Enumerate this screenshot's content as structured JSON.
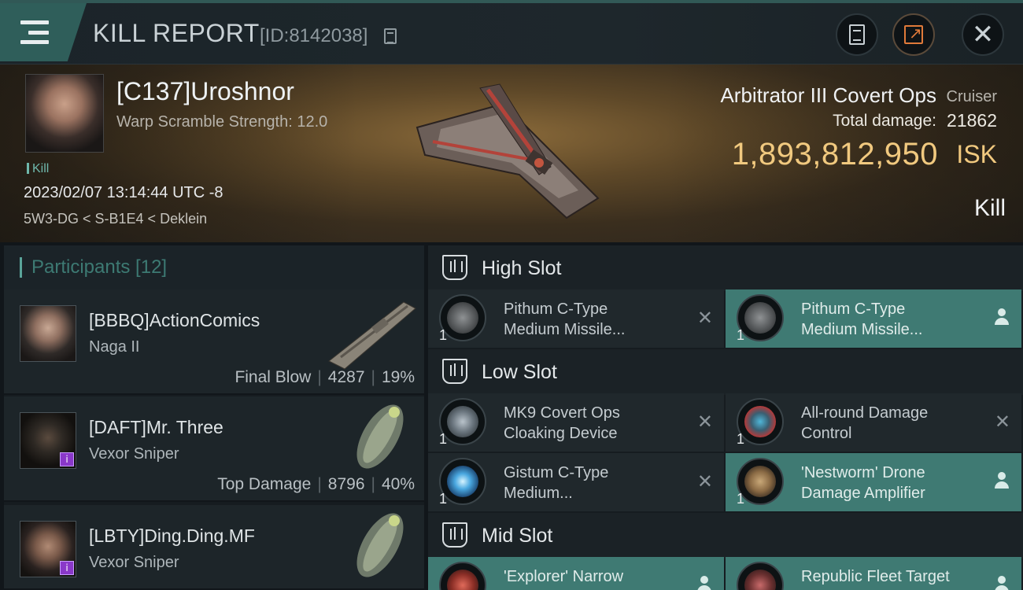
{
  "header": {
    "title": "KILL REPORT",
    "report_id": "[ID:8142038]"
  },
  "victim": {
    "name": "[C137]Uroshnor",
    "warp_scramble": "Warp Scramble Strength: 12.0",
    "tag": "Kill",
    "datetime": "2023/02/07 13:14:44 UTC -8",
    "location": "5W3-DG < S-B1E4 < Deklein",
    "ship_name": "Arbitrator III Covert Ops",
    "ship_class": "Cruiser",
    "total_damage_label": "Total damage:",
    "total_damage": "21862",
    "isk_value": "1,893,812,950",
    "isk_unit": "ISK",
    "result": "Kill"
  },
  "participants": {
    "label": "Participants [12]",
    "items": [
      {
        "name": "[BBBQ]ActionComics",
        "ship": "Naga II",
        "role": "Final Blow",
        "damage": "4287",
        "percent": "19%"
      },
      {
        "name": "[DAFT]Mr. Three",
        "ship": "Vexor Sniper",
        "role": "Top Damage",
        "damage": "8796",
        "percent": "40%"
      },
      {
        "name": "[LBTY]Ding.Ding.MF",
        "ship": "Vexor Sniper",
        "role": "",
        "damage": "",
        "percent": ""
      }
    ]
  },
  "slots": {
    "high": {
      "title": "High Slot",
      "modules": [
        {
          "name_line1": "Pithum C-Type",
          "name_line2": "Medium Missile...",
          "qty": "1",
          "status": "destroyed"
        },
        {
          "name_line1": "Pithum C-Type",
          "name_line2": "Medium Missile...",
          "qty": "1",
          "status": "dropped"
        }
      ]
    },
    "low": {
      "title": "Low Slot",
      "modules": [
        {
          "name_line1": "MK9 Covert Ops",
          "name_line2": "Cloaking Device",
          "qty": "1",
          "status": "destroyed"
        },
        {
          "name_line1": "All-round Damage",
          "name_line2": "Control",
          "qty": "1",
          "status": "destroyed"
        },
        {
          "name_line1": "Gistum C-Type",
          "name_line2": "Medium...",
          "qty": "1",
          "status": "destroyed"
        },
        {
          "name_line1": "'Nestworm' Drone",
          "name_line2": "Damage Amplifier",
          "qty": "1",
          "status": "dropped"
        }
      ]
    },
    "mid": {
      "title": "Mid Slot",
      "modules": [
        {
          "name_line1": "'Explorer' Narrow",
          "name_line2": "",
          "qty": "",
          "status": "dropped"
        },
        {
          "name_line1": "Republic Fleet Target",
          "name_line2": "",
          "qty": "",
          "status": "dropped"
        }
      ]
    }
  },
  "colors": {
    "accent_teal": "#3f7a73",
    "isk_gold": "#f1c97f",
    "badge_purple": "#8a38c9"
  }
}
